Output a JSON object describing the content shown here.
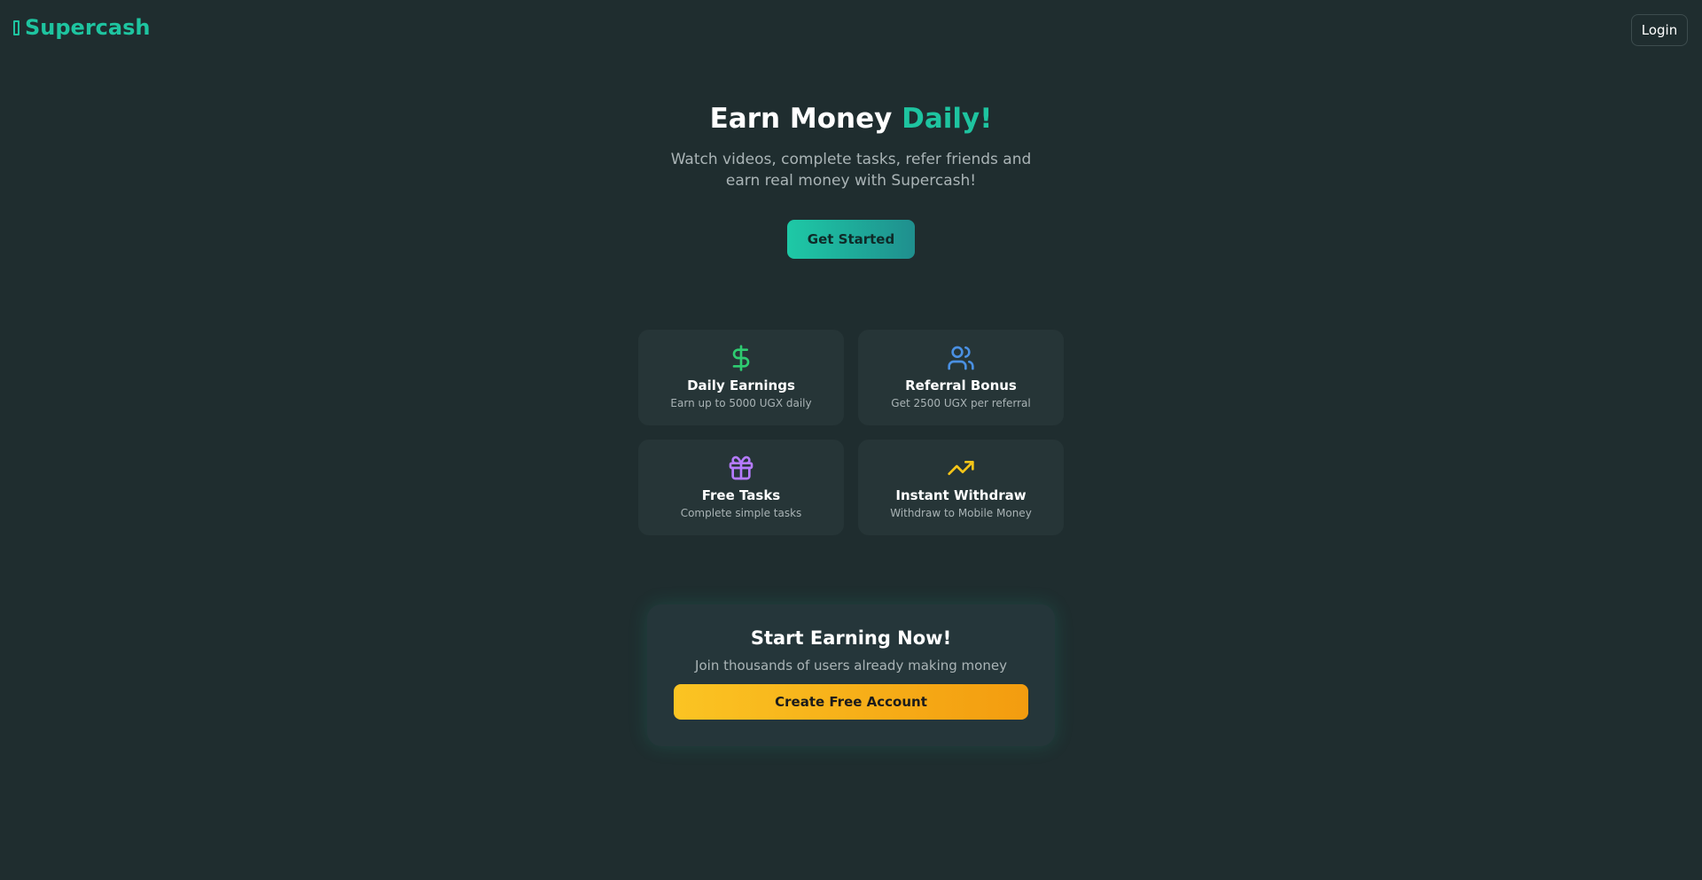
{
  "header": {
    "logo_text": "Supercash",
    "login_label": "Login"
  },
  "hero": {
    "title_main": "Earn Money ",
    "title_accent": "Daily!",
    "subtitle": "Watch videos, complete tasks, refer friends and earn real money with Supercash!",
    "cta_label": "Get Started"
  },
  "features": [
    {
      "icon": "dollar-icon",
      "title": "Daily Earnings",
      "description": "Earn up to 5000 UGX daily",
      "icon_color": "#2ecc71"
    },
    {
      "icon": "users-icon",
      "title": "Referral Bonus",
      "description": "Get 2500 UGX per referral",
      "icon_color": "#4a90e2"
    },
    {
      "icon": "gift-icon",
      "title": "Free Tasks",
      "description": "Complete simple tasks",
      "icon_color": "#b57bff"
    },
    {
      "icon": "trending-up-icon",
      "title": "Instant Withdraw",
      "description": "Withdraw to Mobile Money",
      "icon_color": "#f5c518"
    }
  ],
  "signup": {
    "title": "Start Earning Now!",
    "subtitle": "Join thousands of users already making money",
    "button_label": "Create Free Account"
  },
  "colors": {
    "background": "#1f2d2f",
    "accent": "#1ec4a0",
    "card": "#263537",
    "cta_gradient_start": "#fbc423",
    "cta_gradient_end": "#f39c0f"
  }
}
